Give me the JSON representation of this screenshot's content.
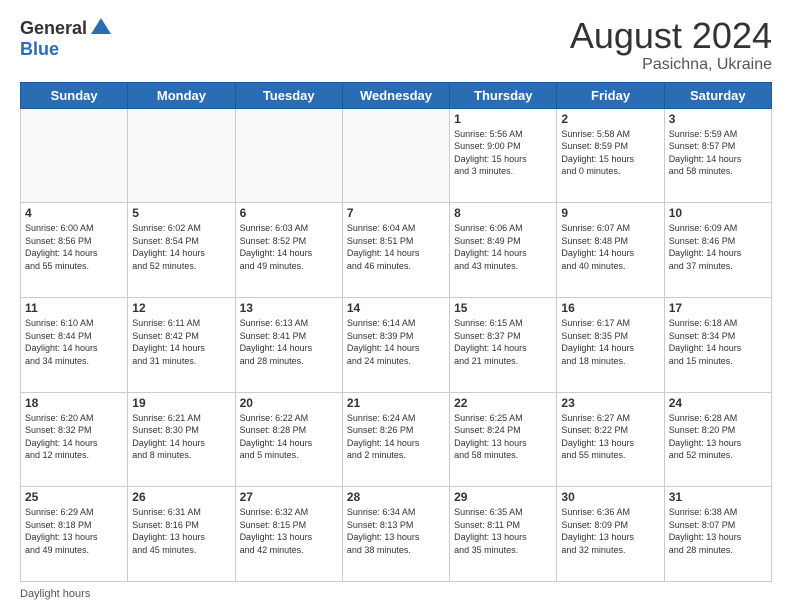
{
  "logo": {
    "general": "General",
    "blue": "Blue"
  },
  "title": {
    "month_year": "August 2024",
    "location": "Pasichna, Ukraine"
  },
  "footer": {
    "daylight_label": "Daylight hours"
  },
  "calendar": {
    "headers": [
      "Sunday",
      "Monday",
      "Tuesday",
      "Wednesday",
      "Thursday",
      "Friday",
      "Saturday"
    ],
    "weeks": [
      [
        {
          "day": "",
          "info": ""
        },
        {
          "day": "",
          "info": ""
        },
        {
          "day": "",
          "info": ""
        },
        {
          "day": "",
          "info": ""
        },
        {
          "day": "1",
          "info": "Sunrise: 5:56 AM\nSunset: 9:00 PM\nDaylight: 15 hours\nand 3 minutes."
        },
        {
          "day": "2",
          "info": "Sunrise: 5:58 AM\nSunset: 8:59 PM\nDaylight: 15 hours\nand 0 minutes."
        },
        {
          "day": "3",
          "info": "Sunrise: 5:59 AM\nSunset: 8:57 PM\nDaylight: 14 hours\nand 58 minutes."
        }
      ],
      [
        {
          "day": "4",
          "info": "Sunrise: 6:00 AM\nSunset: 8:56 PM\nDaylight: 14 hours\nand 55 minutes."
        },
        {
          "day": "5",
          "info": "Sunrise: 6:02 AM\nSunset: 8:54 PM\nDaylight: 14 hours\nand 52 minutes."
        },
        {
          "day": "6",
          "info": "Sunrise: 6:03 AM\nSunset: 8:52 PM\nDaylight: 14 hours\nand 49 minutes."
        },
        {
          "day": "7",
          "info": "Sunrise: 6:04 AM\nSunset: 8:51 PM\nDaylight: 14 hours\nand 46 minutes."
        },
        {
          "day": "8",
          "info": "Sunrise: 6:06 AM\nSunset: 8:49 PM\nDaylight: 14 hours\nand 43 minutes."
        },
        {
          "day": "9",
          "info": "Sunrise: 6:07 AM\nSunset: 8:48 PM\nDaylight: 14 hours\nand 40 minutes."
        },
        {
          "day": "10",
          "info": "Sunrise: 6:09 AM\nSunset: 8:46 PM\nDaylight: 14 hours\nand 37 minutes."
        }
      ],
      [
        {
          "day": "11",
          "info": "Sunrise: 6:10 AM\nSunset: 8:44 PM\nDaylight: 14 hours\nand 34 minutes."
        },
        {
          "day": "12",
          "info": "Sunrise: 6:11 AM\nSunset: 8:42 PM\nDaylight: 14 hours\nand 31 minutes."
        },
        {
          "day": "13",
          "info": "Sunrise: 6:13 AM\nSunset: 8:41 PM\nDaylight: 14 hours\nand 28 minutes."
        },
        {
          "day": "14",
          "info": "Sunrise: 6:14 AM\nSunset: 8:39 PM\nDaylight: 14 hours\nand 24 minutes."
        },
        {
          "day": "15",
          "info": "Sunrise: 6:15 AM\nSunset: 8:37 PM\nDaylight: 14 hours\nand 21 minutes."
        },
        {
          "day": "16",
          "info": "Sunrise: 6:17 AM\nSunset: 8:35 PM\nDaylight: 14 hours\nand 18 minutes."
        },
        {
          "day": "17",
          "info": "Sunrise: 6:18 AM\nSunset: 8:34 PM\nDaylight: 14 hours\nand 15 minutes."
        }
      ],
      [
        {
          "day": "18",
          "info": "Sunrise: 6:20 AM\nSunset: 8:32 PM\nDaylight: 14 hours\nand 12 minutes."
        },
        {
          "day": "19",
          "info": "Sunrise: 6:21 AM\nSunset: 8:30 PM\nDaylight: 14 hours\nand 8 minutes."
        },
        {
          "day": "20",
          "info": "Sunrise: 6:22 AM\nSunset: 8:28 PM\nDaylight: 14 hours\nand 5 minutes."
        },
        {
          "day": "21",
          "info": "Sunrise: 6:24 AM\nSunset: 8:26 PM\nDaylight: 14 hours\nand 2 minutes."
        },
        {
          "day": "22",
          "info": "Sunrise: 6:25 AM\nSunset: 8:24 PM\nDaylight: 13 hours\nand 58 minutes."
        },
        {
          "day": "23",
          "info": "Sunrise: 6:27 AM\nSunset: 8:22 PM\nDaylight: 13 hours\nand 55 minutes."
        },
        {
          "day": "24",
          "info": "Sunrise: 6:28 AM\nSunset: 8:20 PM\nDaylight: 13 hours\nand 52 minutes."
        }
      ],
      [
        {
          "day": "25",
          "info": "Sunrise: 6:29 AM\nSunset: 8:18 PM\nDaylight: 13 hours\nand 49 minutes."
        },
        {
          "day": "26",
          "info": "Sunrise: 6:31 AM\nSunset: 8:16 PM\nDaylight: 13 hours\nand 45 minutes."
        },
        {
          "day": "27",
          "info": "Sunrise: 6:32 AM\nSunset: 8:15 PM\nDaylight: 13 hours\nand 42 minutes."
        },
        {
          "day": "28",
          "info": "Sunrise: 6:34 AM\nSunset: 8:13 PM\nDaylight: 13 hours\nand 38 minutes."
        },
        {
          "day": "29",
          "info": "Sunrise: 6:35 AM\nSunset: 8:11 PM\nDaylight: 13 hours\nand 35 minutes."
        },
        {
          "day": "30",
          "info": "Sunrise: 6:36 AM\nSunset: 8:09 PM\nDaylight: 13 hours\nand 32 minutes."
        },
        {
          "day": "31",
          "info": "Sunrise: 6:38 AM\nSunset: 8:07 PM\nDaylight: 13 hours\nand 28 minutes."
        }
      ]
    ]
  }
}
